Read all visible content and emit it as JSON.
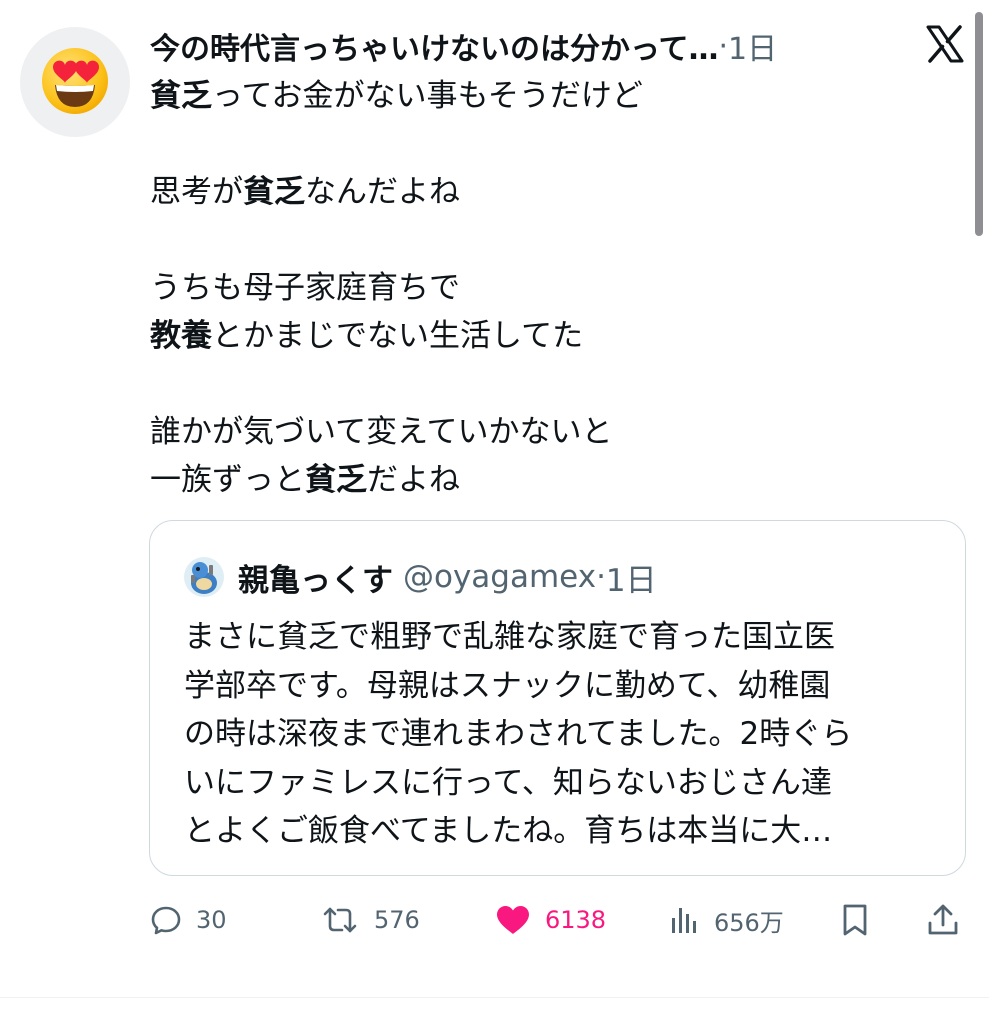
{
  "post": {
    "author_name": "今の時代言っちゃいけないのは分かって…",
    "separator": "·",
    "time": "1日",
    "avatar_icon": "heart-eyes-emoji",
    "brand_icon": "x-logo",
    "lines": [
      {
        "segments": [
          {
            "text": "貧乏",
            "bold": true
          },
          {
            "text": "ってお金がない事もそうだけど",
            "bold": false
          }
        ]
      },
      {
        "blank": true
      },
      {
        "segments": [
          {
            "text": "思考が",
            "bold": false
          },
          {
            "text": "貧乏",
            "bold": true
          },
          {
            "text": "なんだよね",
            "bold": false
          }
        ]
      },
      {
        "blank": true
      },
      {
        "segments": [
          {
            "text": "うちも母子家庭育ちで",
            "bold": false
          }
        ]
      },
      {
        "segments": [
          {
            "text": "教養",
            "bold": true
          },
          {
            "text": "とかまじでない生活してた",
            "bold": false
          }
        ]
      },
      {
        "blank": true
      },
      {
        "segments": [
          {
            "text": "誰かが気づいて変えていかないと",
            "bold": false
          }
        ]
      },
      {
        "segments": [
          {
            "text": "一族ずっと",
            "bold": false
          },
          {
            "text": "貧乏",
            "bold": true
          },
          {
            "text": "だよね",
            "bold": false
          }
        ]
      }
    ]
  },
  "quote": {
    "author_name": "親亀っくす",
    "handle": "@oyagamex",
    "separator": "·",
    "time": "1日",
    "avatar_icon": "turtle-avatar",
    "lines": [
      "まさに貧乏で粗野で乱雑な家庭で育った国立医",
      "学部卒です。母親はスナックに勤めて、幼稚園",
      "の時は深夜まで連れまわされてました。2時ぐら",
      "いにファミレスに行って、知らないおじさん達",
      "とよくご飯食べてましたね。育ちは本当に大…"
    ]
  },
  "actions": {
    "reply": {
      "icon": "reply-icon",
      "count": "30"
    },
    "repost": {
      "icon": "repost-icon",
      "count": "576"
    },
    "like": {
      "icon": "heart-icon",
      "count": "6138",
      "liked": true
    },
    "views": {
      "icon": "views-icon",
      "count": "656万"
    },
    "bookmark": {
      "icon": "bookmark-icon"
    },
    "share": {
      "icon": "share-icon"
    }
  },
  "colors": {
    "text": "#0f1419",
    "secondary": "#536471",
    "like": "#f91880",
    "border": "#cfd9de"
  }
}
